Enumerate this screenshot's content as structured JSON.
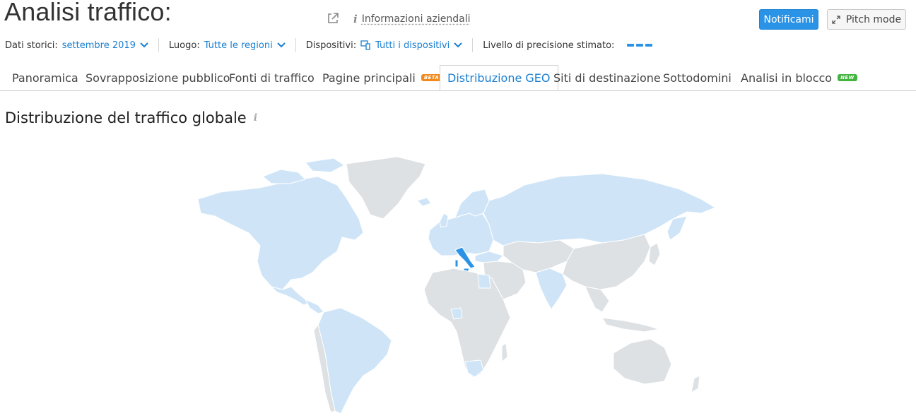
{
  "header": {
    "title": "Analisi traffico:",
    "info_label": "Informazioni aziendali",
    "notify_button": "Notificami",
    "pitch_button": "Pitch mode"
  },
  "filters": {
    "historical_label": "Dati storici:",
    "historical_value": "settembre 2019",
    "location_label": "Luogo:",
    "location_value": "Tutte le regioni",
    "devices_label": "Dispositivi:",
    "devices_value": "Tutti i dispositivi",
    "precision_label": "Livello di precisione stimato:"
  },
  "tabs": [
    {
      "label": "Panoramica"
    },
    {
      "label": "Sovrapposizione pubblico"
    },
    {
      "label": "Fonti di traffico"
    },
    {
      "label": "Pagine principali",
      "badge": "BETA"
    },
    {
      "label": "Distribuzione GEO",
      "active": true
    },
    {
      "label": "Siti di destinazione"
    },
    {
      "label": "Sottodomini"
    },
    {
      "label": "Analisi in blocco",
      "badge": "NEW"
    }
  ],
  "section": {
    "title": "Distribuzione del traffico globale"
  },
  "map": {
    "colors": {
      "no_data": "#dde1e4",
      "low": "#cfe5f7",
      "highlight": "#2b93e6"
    }
  },
  "colors": {
    "accent": "#2b93e6",
    "beta": "#f08a1c",
    "new": "#44b441"
  },
  "icons": [
    "external-link-icon",
    "info-icon",
    "expand-icon",
    "devices-icon",
    "chevron-down-icon"
  ]
}
